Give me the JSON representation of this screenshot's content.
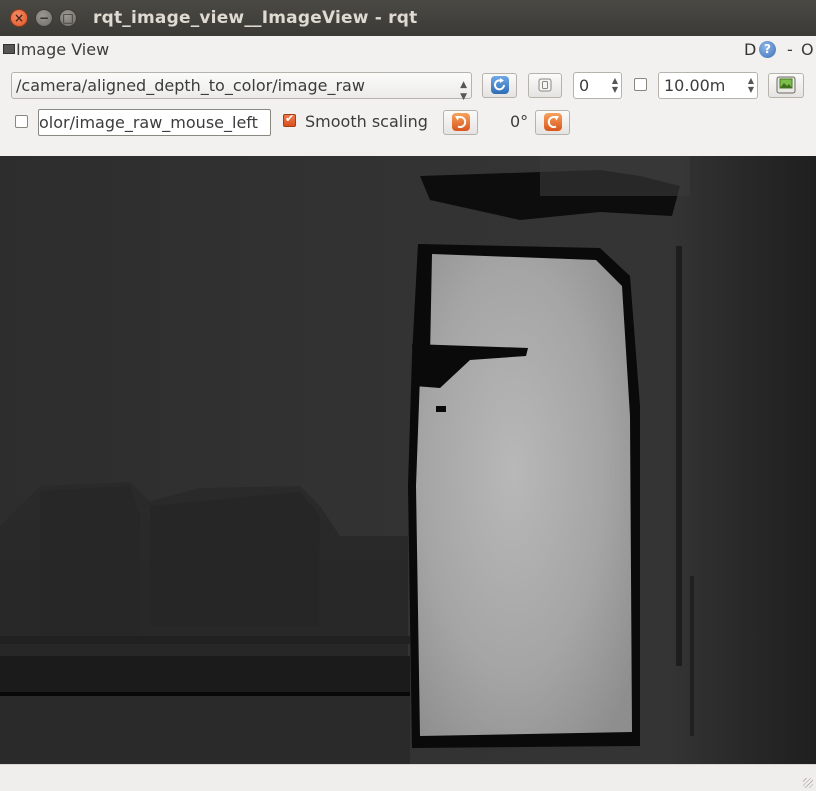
{
  "window": {
    "title": "rqt_image_view__ImageView - rqt",
    "close_glyph": "×",
    "min_glyph": "−",
    "max_glyph": "□"
  },
  "dock": {
    "title": "Image View",
    "d_label": "D",
    "help_glyph": "?",
    "dash_label": "-",
    "o_label": "O"
  },
  "toolbar": {
    "topic": "/camera/aligned_depth_to_color/image_raw",
    "spin_value": "0",
    "max_range": "10.00m",
    "mouse_topic": "olor/image_raw_mouse_left",
    "smooth_scaling_label": "Smooth scaling",
    "smooth_scaling_checked": true,
    "rotation": "0°"
  },
  "colors": {
    "accent": "#e2572a",
    "refresh_blue": "#3b7fc9",
    "rotate_orange": "#e0701e"
  },
  "icons": [
    "close-icon",
    "minimize-icon",
    "maximize-icon",
    "dock-icon",
    "help-icon",
    "refresh-icon",
    "zoom-icon",
    "save-icon",
    "rotate-left-icon",
    "rotate-right-icon"
  ]
}
